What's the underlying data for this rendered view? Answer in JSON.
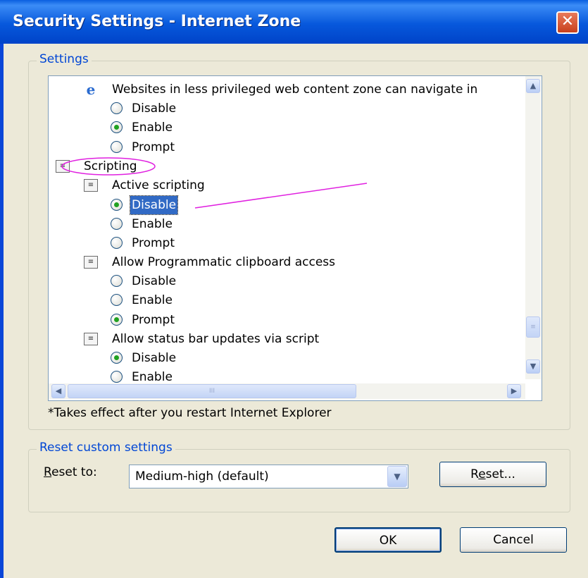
{
  "window": {
    "title": "Security Settings - Internet Zone",
    "close_glyph": "✕"
  },
  "settings_group": {
    "legend": "Settings"
  },
  "tree": {
    "nodes": [
      {
        "label": "Websites in less privileged web content zone can navigate in",
        "icon": "ie-icon"
      },
      {
        "label": "Disable",
        "selected": false
      },
      {
        "label": "Enable",
        "selected": true
      },
      {
        "label": "Prompt",
        "selected": false
      },
      {
        "label": "Scripting",
        "icon": "scripting-icon"
      },
      {
        "label": "Active scripting",
        "icon": "script-icon"
      },
      {
        "label": "Disable",
        "selected": true,
        "highlighted": true
      },
      {
        "label": "Enable",
        "selected": false
      },
      {
        "label": "Prompt",
        "selected": false
      },
      {
        "label": "Allow Programmatic clipboard access",
        "icon": "script-icon"
      },
      {
        "label": "Disable",
        "selected": false
      },
      {
        "label": "Enable",
        "selected": false
      },
      {
        "label": "Prompt",
        "selected": true
      },
      {
        "label": "Allow status bar updates via script",
        "icon": "script-icon"
      },
      {
        "label": "Disable",
        "selected": true
      },
      {
        "label": "Enable",
        "selected": false
      }
    ]
  },
  "scroll": {
    "up": "▲",
    "down": "▼",
    "left": "◀",
    "right": "▶",
    "grip_v": "≡",
    "grip_h": "III"
  },
  "footnote": "*Takes effect after you restart Internet Explorer",
  "reset_group": {
    "legend": "Reset custom settings",
    "reset_to_label_u": "R",
    "reset_to_label_rest": "eset to:",
    "selected_value": "Medium-high (default)",
    "reset_button_pre": "R",
    "reset_button_u": "e",
    "reset_button_post": "set..."
  },
  "buttons": {
    "ok": "OK",
    "cancel": "Cancel"
  },
  "colors": {
    "title_bar": "#0a5fe0",
    "legend_text": "#0046d5",
    "selection": "#316ac5",
    "annotation": "#e020e0"
  }
}
